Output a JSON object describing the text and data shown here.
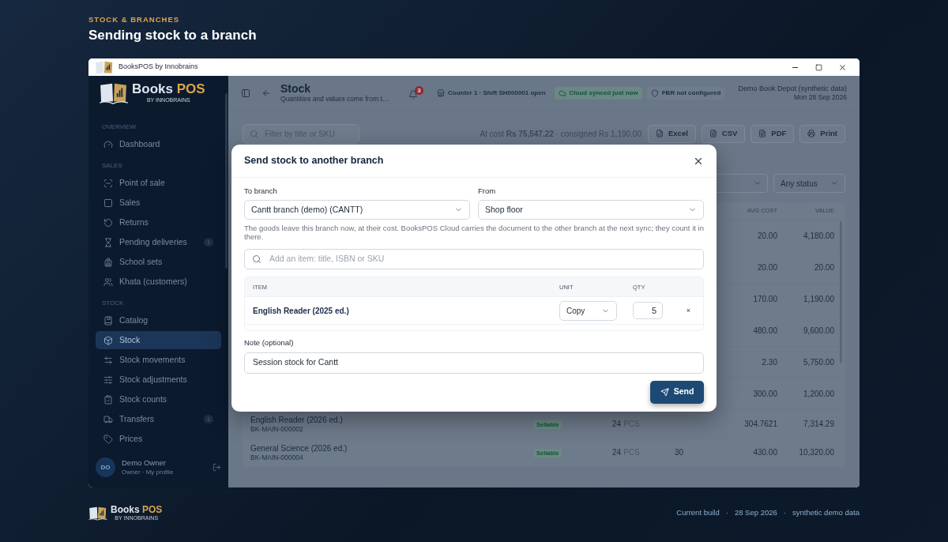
{
  "page": {
    "eyebrow": "STOCK & BRANCHES",
    "title": "Sending stock to a branch"
  },
  "window": {
    "title": "BooksPOS by Innobrains"
  },
  "logo": {
    "name": "Books",
    "accent": "POS",
    "tagline": "BY INNOBRAINS"
  },
  "sidebar": {
    "sections": [
      {
        "heading": "OVERVIEW",
        "items": [
          {
            "label": "Dashboard",
            "selected": false
          }
        ]
      },
      {
        "heading": "SALES",
        "items": [
          {
            "label": "Point of sale",
            "selected": false
          },
          {
            "label": "Sales",
            "selected": false
          },
          {
            "label": "Returns",
            "selected": false
          },
          {
            "label": "Pending deliveries",
            "badge": "1",
            "selected": false
          },
          {
            "label": "School sets",
            "selected": false
          },
          {
            "label": "Khata (customers)",
            "selected": false
          }
        ]
      },
      {
        "heading": "STOCK",
        "items": [
          {
            "label": "Catalog",
            "selected": false
          },
          {
            "label": "Stock",
            "selected": true
          },
          {
            "label": "Stock movements",
            "selected": false
          },
          {
            "label": "Stock adjustments",
            "selected": false
          },
          {
            "label": "Stock counts",
            "selected": false
          },
          {
            "label": "Transfers",
            "badge": "1",
            "selected": false
          },
          {
            "label": "Prices",
            "selected": false
          }
        ]
      }
    ],
    "user": {
      "initials": "DO",
      "name": "Demo Owner",
      "role": "Owner · My profile"
    }
  },
  "header": {
    "title": "Stock",
    "subtitle": "Quantities and values come from t…",
    "notifications": "3",
    "chips": [
      {
        "kind": "counter",
        "label": "Counter 1 · Shift SH000001 open"
      },
      {
        "kind": "cloud",
        "label": "Cloud synced just now"
      },
      {
        "kind": "fbr",
        "label": "FBR not configured"
      }
    ],
    "org": "Demo Book Depot (synthetic data)",
    "date": "Mon 28 Sep 2026"
  },
  "toolbar": {
    "search_placeholder": "Filter by title or SKU",
    "totals": "At cost **Rs 75,547.22** · consigned Rs 1,190.00",
    "exports": [
      "Excel",
      "CSV",
      "PDF",
      "Print"
    ],
    "status_filter": "Any status"
  },
  "table": {
    "columns": [
      "AVG COST",
      "VALUE"
    ],
    "rows": [
      {
        "avg_cost": "20.00",
        "value": "4,180.00"
      },
      {
        "avg_cost": "20.00",
        "value": "20.00"
      },
      {
        "avg_cost": "170.00",
        "value": "1,190.00"
      },
      {
        "avg_cost": "480.00",
        "value": "9,600.00"
      },
      {
        "avg_cost": "2.30",
        "value": "5,750.00"
      },
      {
        "avg_cost": "300.00",
        "value": "1,200.00"
      },
      {
        "title": "English Reader (2026 ed.)",
        "sku": "BK-MAIN-000002",
        "status": "Sellable",
        "qty": "24",
        "unit": "PCS",
        "avg_cost": "304.7621",
        "value": "7,314.29"
      },
      {
        "title": "General Science (2026 ed.)",
        "sku": "BK-MAIN-000004",
        "status": "Sellable",
        "qty": "24",
        "unit": "PCS",
        "column_5": "30",
        "avg_cost": "430.00",
        "value": "10,320.00"
      }
    ]
  },
  "dialog": {
    "title": "Send stock to another branch",
    "to_branch": {
      "label": "To branch",
      "value": "Cantt branch (demo) (CANTT)"
    },
    "from": {
      "label": "From",
      "value": "Shop floor"
    },
    "help": "The goods leave this branch now, at their cost. BooksPOS Cloud carries the document to the other branch at the next sync; they count it in there.",
    "item_search": {
      "placeholder": "Add an item: title, ISBN or SKU"
    },
    "items": {
      "columns": [
        "ITEM",
        "UNIT",
        "QTY"
      ],
      "rows": [
        {
          "name": "English Reader (2025 ed.)",
          "unit": "Copy",
          "qty": "5",
          "remove": "×"
        }
      ]
    },
    "note": {
      "label": "Note (optional)",
      "value": "Session stock for Cantt"
    },
    "send": "Send"
  },
  "footer": {
    "logo": {
      "name": "Books",
      "accent": "POS",
      "tagline": "BY INNOBRAINS"
    },
    "items": [
      "Current build",
      "28 Sep 2026",
      "synthetic demo data"
    ],
    "separator": "·"
  }
}
